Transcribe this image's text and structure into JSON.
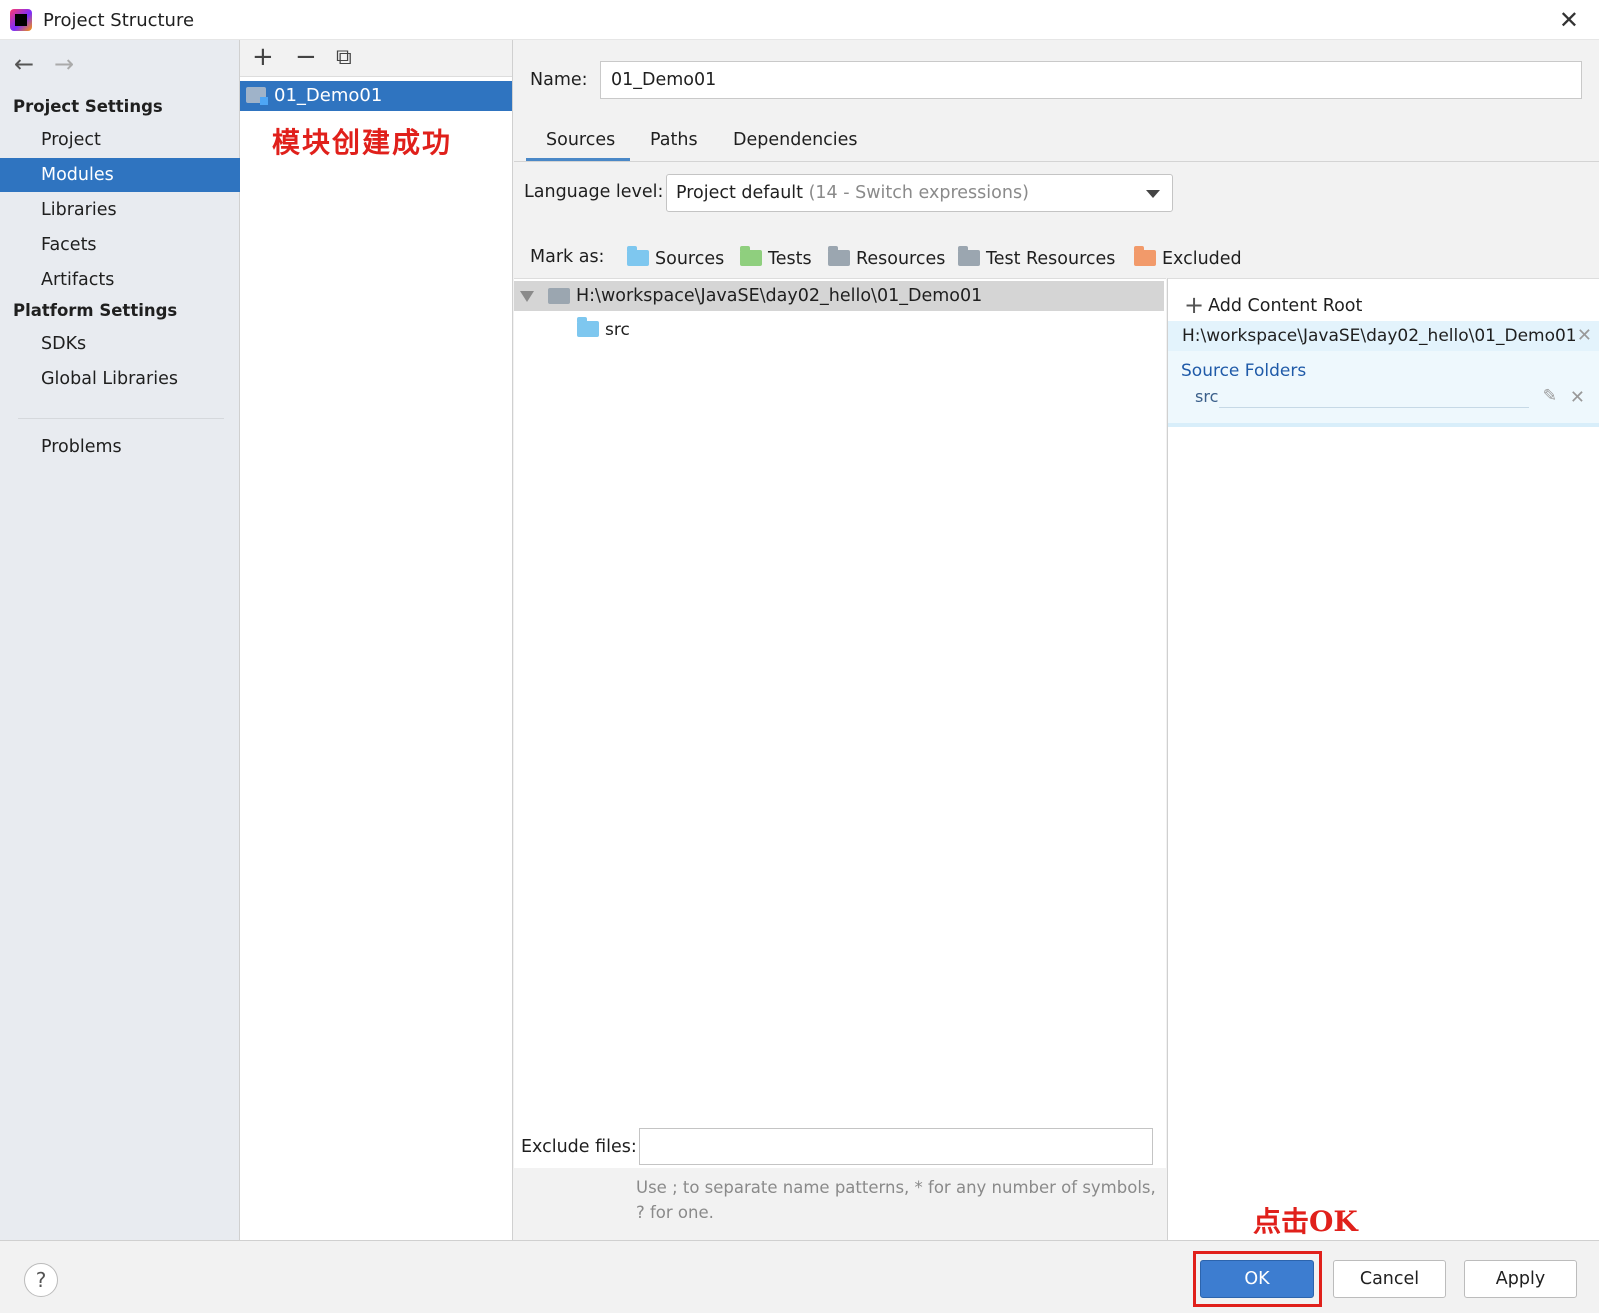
{
  "window": {
    "title": "Project Structure",
    "close_glyph": "✕"
  },
  "sidebar": {
    "back_glyph": "←",
    "forward_glyph": "→",
    "project_settings_title": "Project Settings",
    "project_items": [
      "Project",
      "Modules",
      "Libraries",
      "Facets",
      "Artifacts"
    ],
    "platform_settings_title": "Platform Settings",
    "platform_items": [
      "SDKs",
      "Global Libraries"
    ],
    "problems": "Problems",
    "selected": "Modules"
  },
  "modules": {
    "toolbar": {
      "add": "+",
      "remove": "−",
      "copy": "⧉"
    },
    "items": [
      "01_Demo01"
    ],
    "annotation": "模块创建成功"
  },
  "main": {
    "name_label": "Name:",
    "name_value": "01_Demo01",
    "tabs": [
      "Sources",
      "Paths",
      "Dependencies"
    ],
    "active_tab": "Sources",
    "language_level_label": "Language level:",
    "language_level_value": "Project default",
    "language_level_hint": "(14 - Switch expressions)",
    "mark_as_label": "Mark as:",
    "mark_as": [
      {
        "label": "Sources",
        "color": "#7ec7ef"
      },
      {
        "label": "Tests",
        "color": "#8fcf7e"
      },
      {
        "label": "Resources",
        "color": "#9ba6b0"
      },
      {
        "label": "Test Resources",
        "color": "#9ba6b0"
      },
      {
        "label": "Excluded",
        "color": "#f29a6a"
      }
    ],
    "tree": {
      "root": "H:\\workspace\\JavaSE\\day02_hello\\01_Demo01",
      "children": [
        "src"
      ]
    },
    "content_root": {
      "add_label": "Add Content Root",
      "path": "H:\\workspace\\JavaSE\\day02_hello\\01_Demo01",
      "source_folders_title": "Source Folders",
      "source_folders": [
        "src"
      ]
    },
    "exclude_label": "Exclude files:",
    "exclude_value": "",
    "exclude_hint": "Use ; to separate name patterns, * for any number of symbols, ? for one."
  },
  "footer": {
    "help": "?",
    "ok": "OK",
    "cancel": "Cancel",
    "apply": "Apply",
    "annotation": "点击OK"
  }
}
